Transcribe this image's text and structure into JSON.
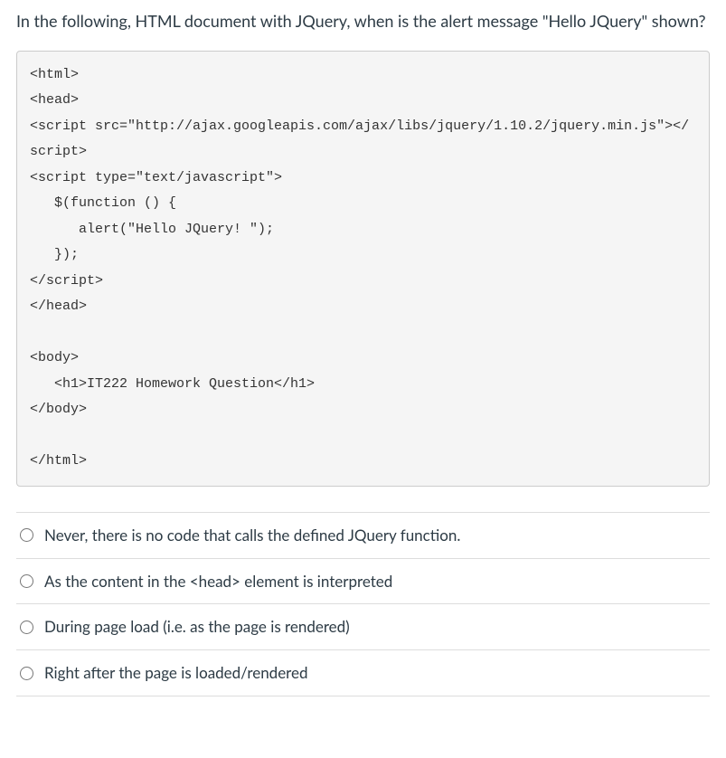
{
  "question": {
    "text": "In the following, HTML document with JQuery, when is the alert message \"Hello JQuery\" shown?"
  },
  "code": "<html>\n<head>\n<script src=\"http://ajax.googleapis.com/ajax/libs/jquery/1.10.2/jquery.min.js\"></script>\n<script type=\"text/javascript\">\n   $(function () {\n      alert(\"Hello JQuery! \");\n   });\n</script>\n</head>\n\n<body>\n   <h1>IT222 Homework Question</h1>\n</body>\n\n</html>",
  "answers": [
    {
      "label": "Never, there is no code that calls the defined JQuery function."
    },
    {
      "label": "As the content in the <head> element is interpreted"
    },
    {
      "label": "During page load (i.e. as the page is rendered)"
    },
    {
      "label": "Right after the page is loaded/rendered"
    }
  ]
}
